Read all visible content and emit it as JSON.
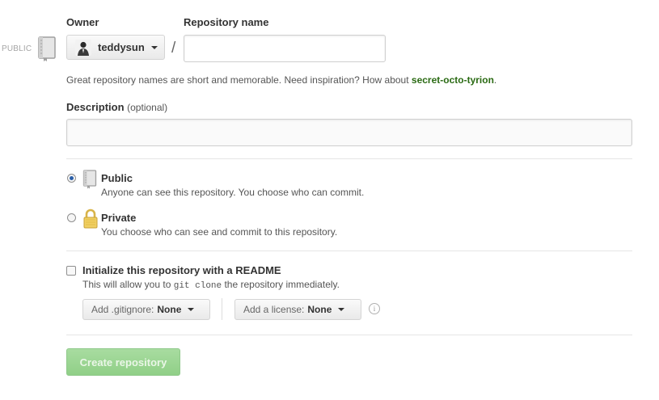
{
  "sidebar": {
    "visibility_label": "PUBLIC",
    "icon": "repo-book-icon"
  },
  "owner": {
    "label": "Owner",
    "selected": "teddysun",
    "icon": "avatar"
  },
  "repo_name": {
    "label": "Repository name",
    "separator": "/",
    "value": "",
    "placeholder": ""
  },
  "hint": {
    "text": "Great repository names are short and memorable. Need inspiration? How about ",
    "suggestion": "secret-octo-tyrion",
    "suffix": "."
  },
  "description": {
    "label": "Description",
    "optional": "(optional)",
    "value": "",
    "placeholder": ""
  },
  "visibility": {
    "public": {
      "title": "Public",
      "desc": "Anyone can see this repository. You choose who can commit.",
      "checked": true,
      "icon": "repo-book-icon"
    },
    "private": {
      "title": "Private",
      "desc": "You choose who can see and commit to this repository.",
      "checked": false,
      "icon": "lock-icon"
    }
  },
  "readme": {
    "label": "Initialize this repository with a README",
    "desc_before": "This will allow you to ",
    "desc_code": "git clone",
    "desc_after": " the repository immediately.",
    "checked": false
  },
  "gitignore": {
    "label": "Add .gitignore:",
    "value": "None"
  },
  "license": {
    "label": "Add a license:",
    "value": "None"
  },
  "info_icon": "info-icon",
  "create_button": {
    "label": "Create repository",
    "enabled": false,
    "color": "#98d38f"
  }
}
